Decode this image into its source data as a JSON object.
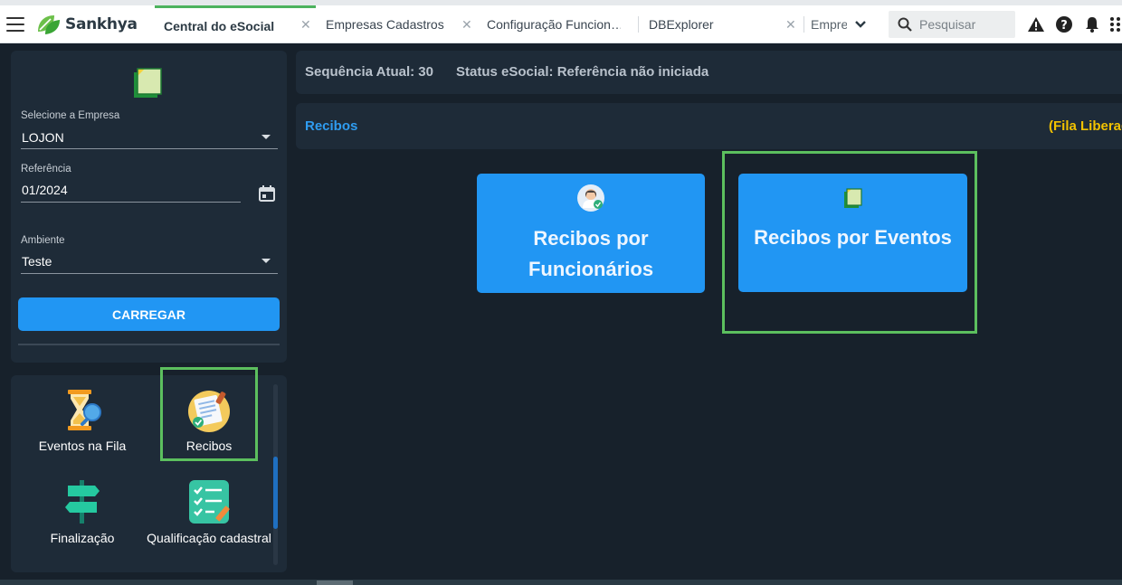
{
  "app": {
    "brand": "Sankhya"
  },
  "tabs": [
    {
      "label": "Central do eSocial",
      "active": true
    },
    {
      "label": "Empresas Cadastros",
      "active": false
    },
    {
      "label": "Configuração Funcion…",
      "active": false
    },
    {
      "label": "DBExplorer",
      "active": false
    },
    {
      "label": "Empre:",
      "active": false
    }
  ],
  "search": {
    "placeholder": "Pesquisar"
  },
  "filters": {
    "empresa": {
      "label": "Selecione a Empresa",
      "value": "LOJON"
    },
    "referencia": {
      "label": "Referência",
      "value": "01/2024"
    },
    "ambiente": {
      "label": "Ambiente",
      "value": "Teste"
    },
    "carregar_label": "CARREGAR"
  },
  "menu": [
    {
      "label": "Eventos na Fila",
      "icon": "hourglass-icon"
    },
    {
      "label": "Recibos",
      "icon": "receipt-icon"
    },
    {
      "label": "Finalização",
      "icon": "signpost-icon"
    },
    {
      "label": "Qualificação cadastral",
      "icon": "checklist-icon"
    }
  ],
  "status": {
    "sequencia": "Sequência Atual: 30",
    "status_esocial": "Status eSocial: Referência não iniciada"
  },
  "recibos": {
    "title": "Recibos",
    "fila": "(Fila Liberada)",
    "btn_funcionarios": "Recibos por Funcionários",
    "btn_eventos": "Recibos por Eventos"
  },
  "colors": {
    "accent": "#2196f3",
    "highlight": "#5cbf5e",
    "fila": "#f2c200",
    "brand_green": "#4db35e"
  }
}
